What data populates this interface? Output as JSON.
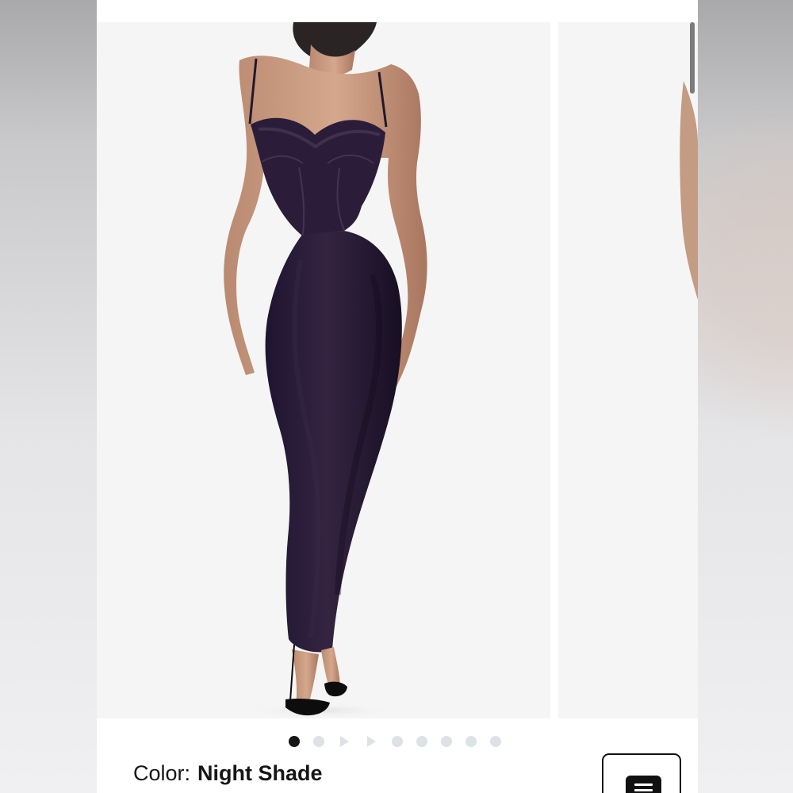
{
  "product": {
    "color_label": "Color:",
    "color_value": "Night Shade"
  },
  "gallery": {
    "slides_total": 9,
    "active_slide": 1,
    "dress_color": "#2a1d38"
  },
  "icons": {
    "menu": "menu-icon"
  }
}
